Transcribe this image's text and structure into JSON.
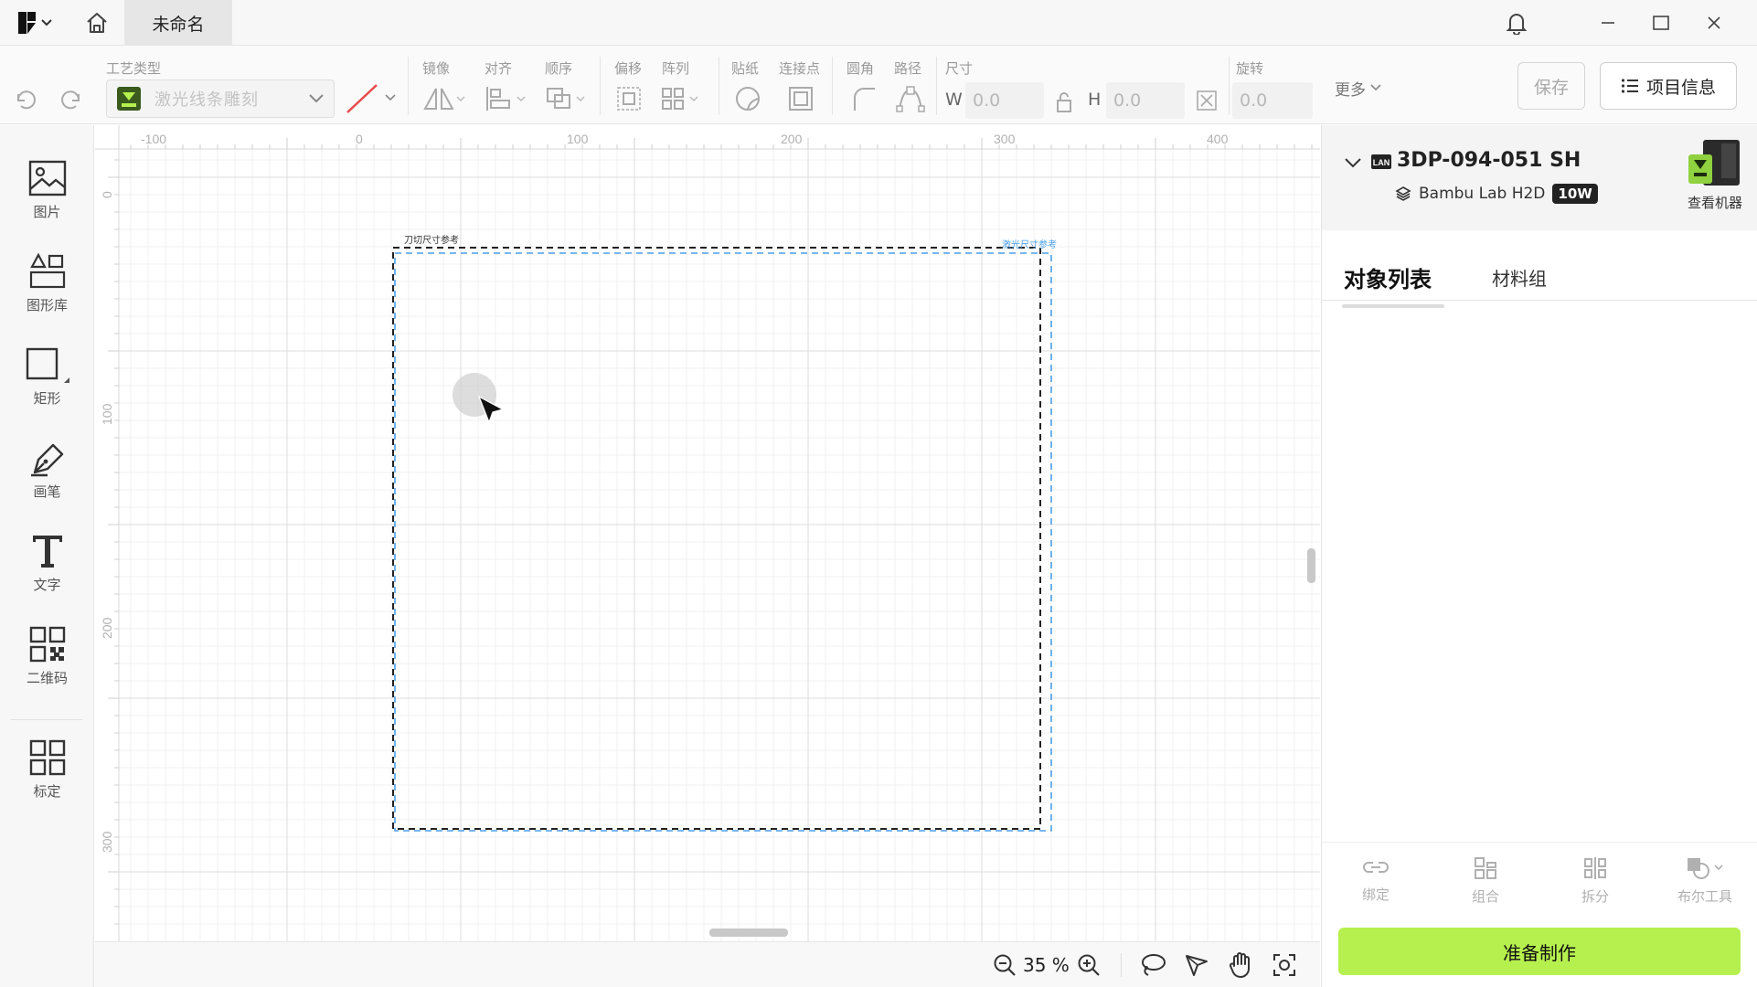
{
  "app": {
    "doc_tab": "未命名"
  },
  "toolbar": {
    "groups": {
      "process_type": "工艺类型",
      "mirror": "镜像",
      "align": "对齐",
      "order": "顺序",
      "offset": "偏移",
      "array": "阵列",
      "sticker": "贴纸",
      "connect": "连接点",
      "corner": "圆角",
      "path": "路径",
      "size": "尺寸",
      "rotate": "旋转"
    },
    "process_value": "激光线条雕刻",
    "width_label": "W",
    "width_value": "0.0",
    "height_label": "H",
    "height_value": "0.0",
    "rotate_value": "0.0",
    "more": "更多",
    "save": "保存",
    "project_info": "项目信息"
  },
  "sidebar": {
    "items": [
      {
        "label": "图片",
        "icon": "image-icon"
      },
      {
        "label": "图形库",
        "icon": "shape-library-icon"
      },
      {
        "label": "矩形",
        "icon": "rectangle-icon"
      },
      {
        "label": "画笔",
        "icon": "pen-icon"
      },
      {
        "label": "文字",
        "icon": "text-icon"
      },
      {
        "label": "二维码",
        "icon": "qrcode-icon"
      },
      {
        "label": "标定",
        "icon": "calibrate-icon"
      }
    ]
  },
  "canvas": {
    "ruler_x": [
      "-100",
      "0",
      "100",
      "200",
      "300",
      "400"
    ],
    "ruler_y": [
      "0",
      "100",
      "200",
      "300"
    ],
    "blade_ref_label": "刀切尺寸参考",
    "laser_ref_label": "激光尺寸参考"
  },
  "bottombar": {
    "zoom": "35 %"
  },
  "machine": {
    "name": "3DP-094-051 SH",
    "model": "Bambu Lab H2D",
    "power": "10W",
    "view_label": "查看机器"
  },
  "panel": {
    "tab_objects": "对象列表",
    "tab_materials": "材料组",
    "tools": [
      {
        "label": "绑定",
        "icon": "link-icon"
      },
      {
        "label": "组合",
        "icon": "group-icon"
      },
      {
        "label": "拆分",
        "icon": "split-icon"
      },
      {
        "label": "布尔工具",
        "icon": "boolean-icon"
      }
    ],
    "prepare": "准备制作"
  },
  "colors": {
    "accent_green": "#b6f04e",
    "laser_ref_blue": "#4a9ee8",
    "blade_ref_black": "#222222"
  }
}
